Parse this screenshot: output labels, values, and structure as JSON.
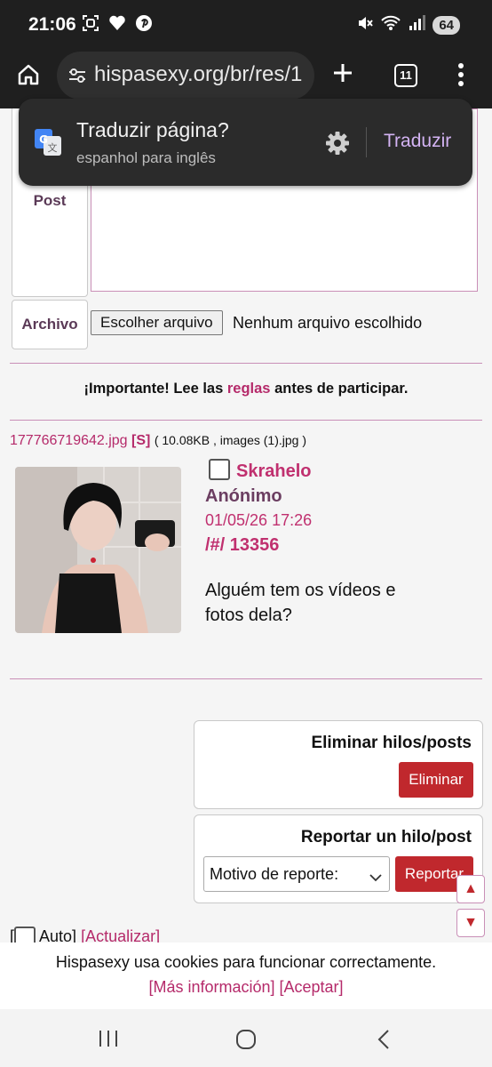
{
  "status_bar": {
    "time": "21:06",
    "battery": "64",
    "icons_left": [
      "screenshot-icon",
      "heart-icon",
      "pinterest-icon"
    ],
    "icons_right": [
      "mute-icon",
      "wifi-icon",
      "signal-icon"
    ]
  },
  "browser": {
    "url": "hispasexy.org/br/res/1",
    "tab_count": "11"
  },
  "translate_popup": {
    "title": "Traduzir página?",
    "subtitle": "espanhol para inglês",
    "action": "Traduzir"
  },
  "form": {
    "post_label": "Post",
    "file_label": "Archivo",
    "file_button": "Escolher arquivo",
    "file_status": "Nenhum arquivo escolhido"
  },
  "notice": {
    "before": "¡Importante! Lee las ",
    "link": "reglas",
    "after": " antes de participar."
  },
  "post": {
    "filename": "177766719642.jpg",
    "search_link": "[S]",
    "file_meta": " ( 10.08KB , images (1).jpg )",
    "subject": "Skrahelo",
    "name": "Anónimo",
    "date": "01/05/26 17:26",
    "number": "/#/ 13356",
    "message": "Alguém tem os vídeos e fotos dela?"
  },
  "delete_box": {
    "title": "Eliminar hilos/posts",
    "button": "Eliminar"
  },
  "report_box": {
    "title": "Reportar un hilo/post",
    "select_value": "Motivo de reporte:",
    "button": "Reportar"
  },
  "auto_update": {
    "open": "[",
    "label": " Auto] ",
    "link": "[Actualizar]"
  },
  "cookie_banner": {
    "text": "Hispasexy usa cookies para funcionar correctamente.",
    "links": "[Más información] [Aceptar]"
  },
  "colors": {
    "accent": "#c0306f",
    "button_red": "#c0282d",
    "border_pink": "#c98fb7",
    "chrome_dark": "#1f1f1f"
  }
}
